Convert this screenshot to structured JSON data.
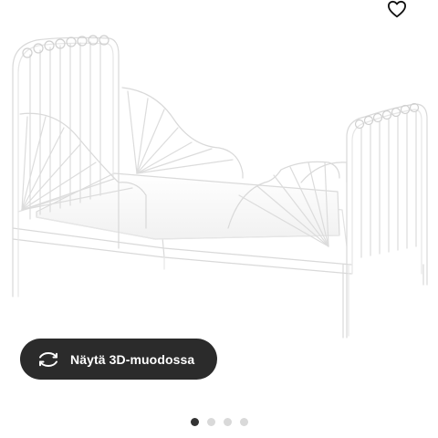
{
  "product_image": {
    "alt_subject": "white metal extendable child bed"
  },
  "favorite": {
    "icon": "heart-outline-icon"
  },
  "view3d": {
    "label": "Näytä 3D-muodossa",
    "icon": "rotate-3d-icon",
    "background_color": "#2b2b2b",
    "text_color": "#ffffff"
  },
  "carousel": {
    "total_images": 4,
    "active_index": 0
  }
}
